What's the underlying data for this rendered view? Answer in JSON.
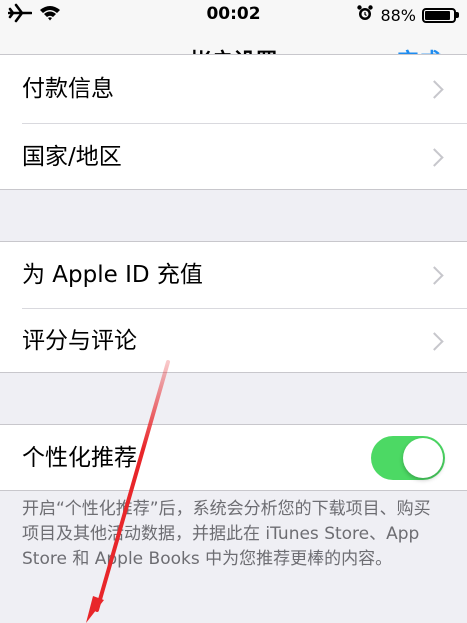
{
  "status_bar": {
    "time": "00:02",
    "battery_percent": "88%",
    "battery_level": 0.88,
    "icons": [
      "airplane-icon",
      "wifi-icon",
      "alarm-icon",
      "battery-icon"
    ]
  },
  "nav": {
    "title": "帐户设置",
    "done_label": "完成"
  },
  "groups": [
    {
      "items": [
        {
          "label": "付款信息",
          "accessory": "chevron-right-icon"
        },
        {
          "label": "国家/地区",
          "accessory": "chevron-right-icon"
        }
      ]
    },
    {
      "items": [
        {
          "label": "为 Apple ID 充值",
          "accessory": "chevron-right-icon"
        },
        {
          "label": "评分与评论",
          "accessory": "chevron-right-icon"
        }
      ]
    },
    {
      "items": [
        {
          "label": "个性化推荐",
          "toggle_on": true
        }
      ]
    }
  ],
  "footnote": "开启“个性化推荐”后，系统会分析您的下载项目、购买项目及其他活动数据，并据此在 iTunes Store、App Store 和 Apple Books 中为您推荐更棒的内容。",
  "colors": {
    "accent": "#1e8cf0",
    "toggle_on": "#4cd964",
    "background": "#efeff4",
    "annotation_arrow": "#e8262a"
  }
}
